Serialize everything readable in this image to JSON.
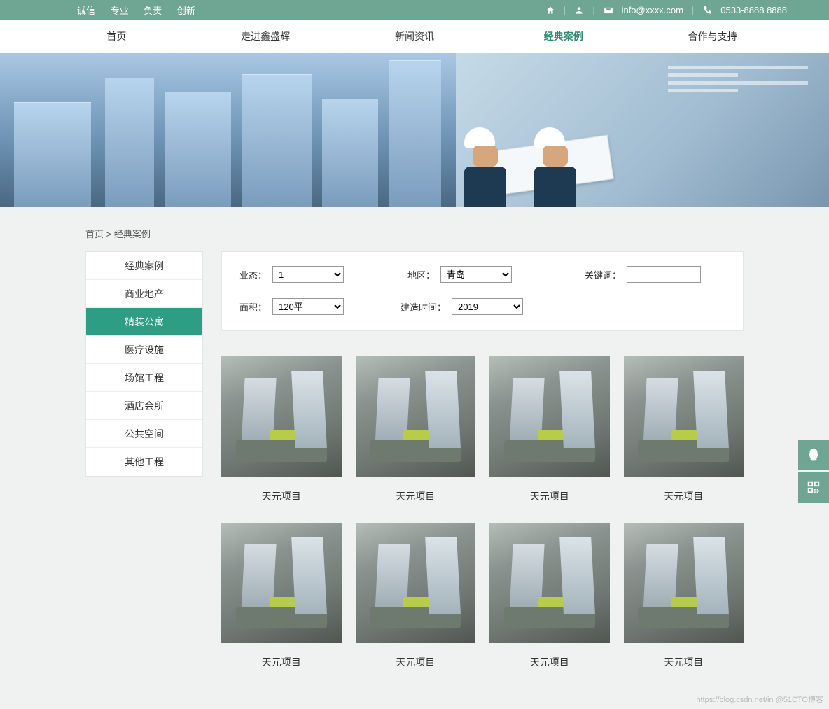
{
  "topbar": {
    "tags": [
      "诚信",
      "专业",
      "负责",
      "创新"
    ],
    "email": "info@xxxx.com",
    "phone": "0533-8888 8888"
  },
  "nav": {
    "items": [
      "首页",
      "走进鑫盛辉",
      "新闻资讯",
      "经典案例",
      "合作与支持"
    ],
    "active_index": 3
  },
  "breadcrumb": {
    "home": "首页",
    "sep": ">",
    "current": "经典案例"
  },
  "sidebar": {
    "items": [
      "经典案例",
      "商业地产",
      "精装公寓",
      "医疗设施",
      "场馆工程",
      "酒店会所",
      "公共空间",
      "其他工程"
    ],
    "active_index": 2
  },
  "filter": {
    "yetai": {
      "label": "业态：",
      "value": "1"
    },
    "diqu": {
      "label": "地区：",
      "value": "青岛"
    },
    "keyword": {
      "label": "关键词：",
      "value": ""
    },
    "mianji": {
      "label": "面积：",
      "value": "120平"
    },
    "time": {
      "label": "建造时间：",
      "value": "2019"
    }
  },
  "projects": [
    {
      "title": "天元项目"
    },
    {
      "title": "天元项目"
    },
    {
      "title": "天元项目"
    },
    {
      "title": "天元项目"
    },
    {
      "title": "天元项目"
    },
    {
      "title": "天元项目"
    },
    {
      "title": "天元项目"
    },
    {
      "title": "天元项目"
    }
  ],
  "watermark": "https://blog.csdn.net/in @51CTO博客"
}
